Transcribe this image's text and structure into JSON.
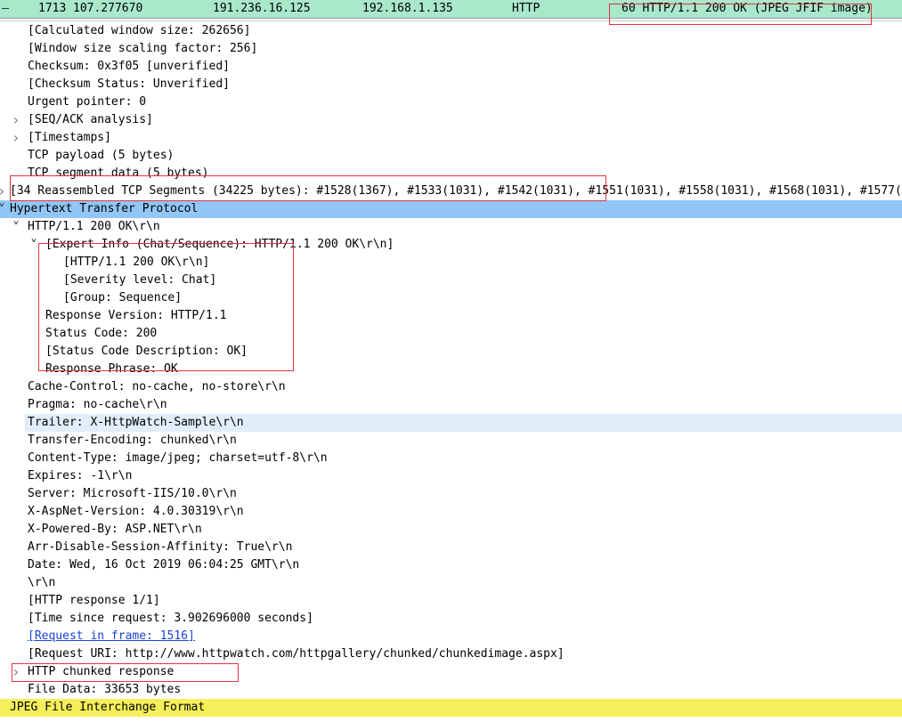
{
  "packet_row": {
    "number": "1713",
    "time": "107.277670",
    "source": "191.236.16.125",
    "destination": "192.168.1.135",
    "protocol": "HTTP",
    "info": "60 HTTP/1.1 200 OK  (JPEG JFIF image)"
  },
  "details": [
    {
      "text": "[Calculated window size: 262656]",
      "level": 1
    },
    {
      "text": "[Window size scaling factor: 256]",
      "level": 1
    },
    {
      "text": "Checksum: 0x3f05 [unverified]",
      "level": 1
    },
    {
      "text": "[Checksum Status: Unverified]",
      "level": 1
    },
    {
      "text": "Urgent pointer: 0",
      "level": 1
    },
    {
      "text": "[SEQ/ACK analysis]",
      "level": 1,
      "expander": "collapsed"
    },
    {
      "text": "[Timestamps]",
      "level": 1,
      "expander": "collapsed"
    },
    {
      "text": "TCP payload (5 bytes)",
      "level": 1
    },
    {
      "text": "TCP segment data (5 bytes)",
      "level": 1
    },
    {
      "text": "[34 Reassembled TCP Segments (34225 bytes): #1528(1367), #1533(1031), #1542(1031), #1551(1031), #1558(1031), #1568(1031), #1577(1031)",
      "level": 0,
      "expander": "collapsed"
    },
    {
      "text": "Hypertext Transfer Protocol",
      "level": 0,
      "expander": "expanded",
      "style": "selected"
    },
    {
      "text": "HTTP/1.1 200 OK\\r\\n",
      "level": 1,
      "expander": "expanded"
    },
    {
      "text": "[Expert Info (Chat/Sequence): HTTP/1.1 200 OK\\r\\n]",
      "level": 2,
      "expander": "expanded"
    },
    {
      "text": "[HTTP/1.1 200 OK\\r\\n]",
      "level": 3
    },
    {
      "text": "[Severity level: Chat]",
      "level": 3
    },
    {
      "text": "[Group: Sequence]",
      "level": 3
    },
    {
      "text": "Response Version: HTTP/1.1",
      "level": 2
    },
    {
      "text": "Status Code: 200",
      "level": 2
    },
    {
      "text": "[Status Code Description: OK]",
      "level": 2
    },
    {
      "text": "Response Phrase: OK",
      "level": 2
    },
    {
      "text": "Cache-Control: no-cache, no-store\\r\\n",
      "level": 1
    },
    {
      "text": "Pragma: no-cache\\r\\n",
      "level": 1
    },
    {
      "text": "Trailer: X-HttpWatch-Sample\\r\\n",
      "level": 1,
      "style": "hover"
    },
    {
      "text": "Transfer-Encoding: chunked\\r\\n",
      "level": 1
    },
    {
      "text": "Content-Type: image/jpeg; charset=utf-8\\r\\n",
      "level": 1
    },
    {
      "text": "Expires: -1\\r\\n",
      "level": 1
    },
    {
      "text": "Server: Microsoft-IIS/10.0\\r\\n",
      "level": 1
    },
    {
      "text": "X-AspNet-Version: 4.0.30319\\r\\n",
      "level": 1
    },
    {
      "text": "X-Powered-By: ASP.NET\\r\\n",
      "level": 1
    },
    {
      "text": "Arr-Disable-Session-Affinity: True\\r\\n",
      "level": 1
    },
    {
      "text": "Date: Wed, 16 Oct 2019 06:04:25 GMT\\r\\n",
      "level": 1
    },
    {
      "text": "\\r\\n",
      "level": 1
    },
    {
      "text": "[HTTP response 1/1]",
      "level": 1
    },
    {
      "text": "[Time since request: 3.902696000 seconds]",
      "level": 1
    },
    {
      "text": "[Request in frame: 1516]",
      "level": 1,
      "style": "link"
    },
    {
      "text": "[Request URI: http://www.httpwatch.com/httpgallery/chunked/chunkedimage.aspx]",
      "level": 1
    },
    {
      "text": "HTTP chunked response",
      "level": 1,
      "expander": "collapsed"
    },
    {
      "text": "File Data: 33653 bytes",
      "level": 1
    },
    {
      "text": "JPEG File Interchange Format",
      "level": 0,
      "style": "jpeg"
    }
  ],
  "colors": {
    "packet_row_bg": "#a9e8cb",
    "selected_bg": "#91c6f7",
    "jpeg_bg": "#f5ef5b",
    "hover_bg": "#e1eef9",
    "annotation_red": "#e0353b",
    "link": "#1a43d6"
  },
  "icons": {
    "collapsed": "chevron-right-icon",
    "expanded": "chevron-down-icon"
  }
}
